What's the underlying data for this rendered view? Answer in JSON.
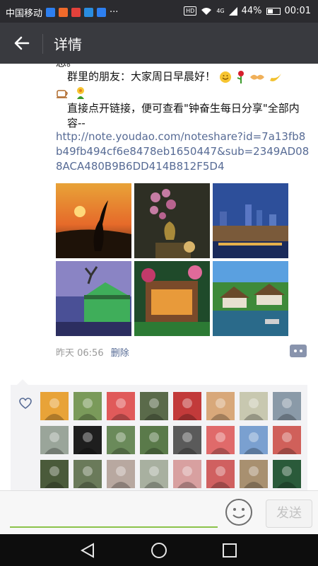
{
  "status_bar": {
    "carrier": "中国移动",
    "app_icon_colors": [
      "#2d7ff0",
      "#f06a2b",
      "#e2413b",
      "#2a8de0",
      "#2d7ff0"
    ],
    "more": "···",
    "hd": "HD",
    "network": "4G",
    "battery": "44%",
    "time": "00:01"
  },
  "header": {
    "title": "详情"
  },
  "post": {
    "line_partial": "息。",
    "greeting": "群里的朋友：大家周日早晨好！",
    "greeting_emojis": [
      "smile-emoji",
      "rose-emoji",
      "handshake-emoji",
      "banana-emoji"
    ],
    "line2_emojis": [
      "coffee-emoji",
      "flower-person-emoji"
    ],
    "instruction": "直接点开链接，便可查看\"钟奋生每日分享\"全部内容--",
    "link": "http://note.youdao.com/noteshare?id=7a13fb8b49fb494cf6e8478eb1650447&sub=2349AD088ACA480B9B6DD414B812F5D4",
    "photos": [
      "sunset-crane",
      "orchid-vase",
      "city-night",
      "windmill-house",
      "garden-patio",
      "village-canal"
    ],
    "time": "昨天 06:56",
    "delete": "删除"
  },
  "likes": {
    "icon": "heart-icon",
    "avatar_count": 24
  },
  "input_bar": {
    "placeholder": "",
    "send": "发送"
  },
  "nav_bar": {
    "buttons": [
      "back-triangle",
      "home-circle",
      "recents-square"
    ]
  }
}
